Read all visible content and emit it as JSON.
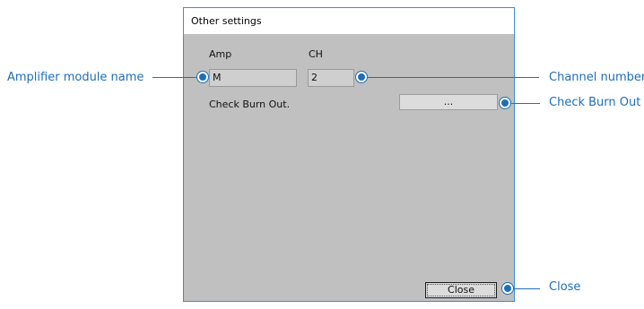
{
  "dialog": {
    "title": "Other settings",
    "amp_label": "Amp",
    "ch_label": "CH",
    "amp_value": "M",
    "ch_value": "2",
    "check_burn_out_label": "Check Burn Out.",
    "browse_button_label": "...",
    "close_button_label": "Close"
  },
  "callouts": {
    "amplifier_module_name": "Amplifier module name",
    "channel_number": "Channel number",
    "check_burn_out": "Check Burn Out",
    "close": "Close"
  },
  "colors": {
    "accent": "#1e6eb7",
    "dialog_bg": "#c0c0c0",
    "title_border": "#3a8fd4"
  }
}
